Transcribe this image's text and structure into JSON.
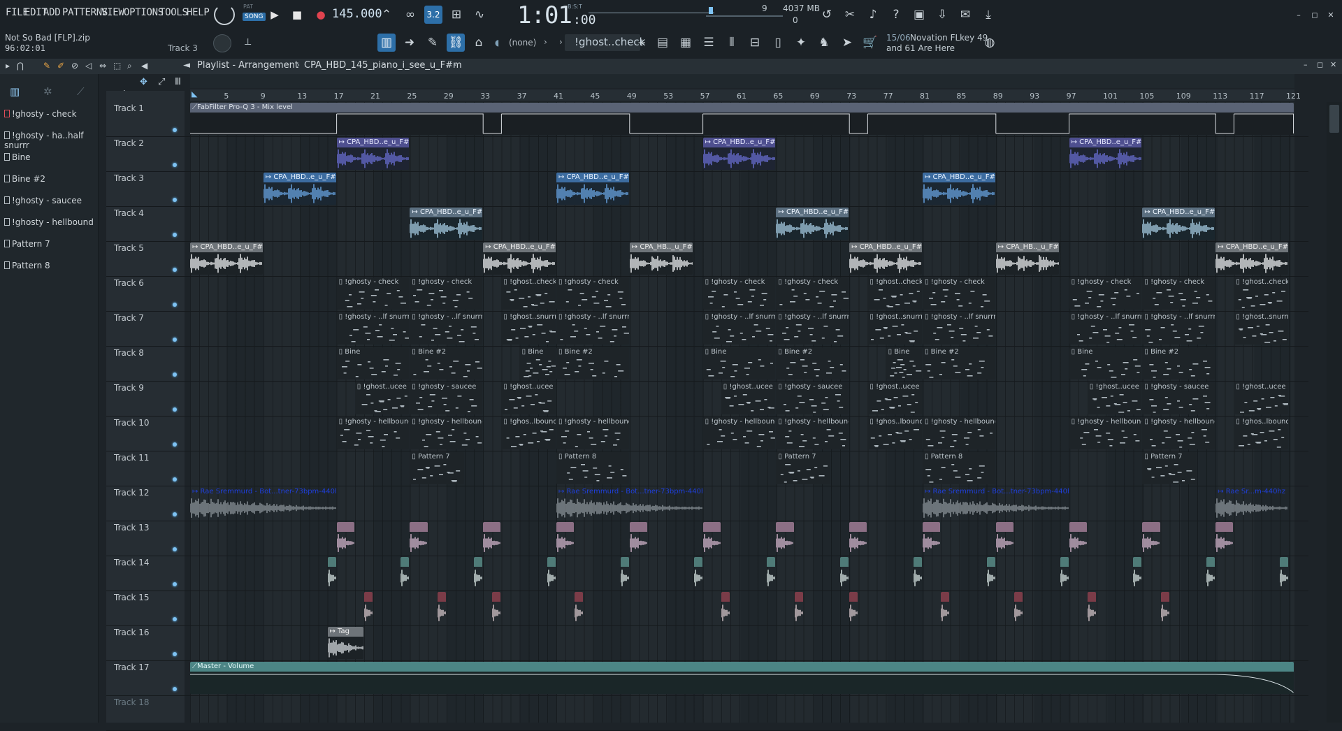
{
  "menu": [
    "FILE",
    "EDIT",
    "ADD",
    "PATTERNS",
    "VIEW",
    "OPTIONS",
    "TOOLS",
    "HELP"
  ],
  "mode": {
    "pat": "PAT",
    "song": "SONG"
  },
  "tempo": "145.000",
  "clock": {
    "main": "1:01",
    "sub": ":00",
    "label": "B:S:T"
  },
  "monitor": {
    "poly": "9",
    "mem": "4037 MB",
    "cpu": "0"
  },
  "project": {
    "name": "Not So Bad [FLP].zip",
    "time": "96:02:01"
  },
  "hint": "Track 3",
  "pattern_selector": {
    "current": "!ghost..check",
    "channel": "(none)"
  },
  "midi": {
    "count": "15/06",
    "device": "Novation FLkey 49",
    "more": "and 61 Are Here"
  },
  "playlist": {
    "title": "Playlist - Arrangement",
    "separator": "›",
    "arrangement": "CPA_HBD_145_piano_i_see_u_F#m"
  },
  "picker": [
    "!ghosty - check",
    "!ghosty - ha..half snurrr",
    "Bine",
    "Bine #2",
    "!ghosty - saucee",
    "!ghosty - hellbound",
    "Pattern 7",
    "Pattern 8"
  ],
  "ruler": [
    "5",
    "9",
    "13",
    "17",
    "21",
    "25",
    "29",
    "33",
    "37",
    "41",
    "45",
    "49",
    "53",
    "57",
    "61",
    "65",
    "69",
    "73",
    "77",
    "81",
    "85",
    "89",
    "93",
    "97",
    "101",
    "105",
    "109",
    "113",
    "117",
    "121"
  ],
  "tracks": [
    "Track 1",
    "Track 2",
    "Track 3",
    "Track 4",
    "Track 5",
    "Track 6",
    "Track 7",
    "Track 8",
    "Track 9",
    "Track 10",
    "Track 11",
    "Track 12",
    "Track 13",
    "Track 14",
    "Track 15",
    "Track 16",
    "Track 17",
    "Track 18"
  ],
  "clips": {
    "automation1": "FabFilter Pro-Q 3 - Mix level",
    "audio_full": "CPA_HBD..e_u_F#m",
    "audio_short": "CPA_HB.._u_F#m",
    "ghost_check": "!ghosty - check",
    "ghost_check_s": "!ghost..check",
    "ghost_snurrr": "!ghosty - ..lf snurrr",
    "ghost_snurrr_s": "!ghost..snurrr",
    "bine": "Bine",
    "bine2": "Bine #2",
    "saucee": "!ghosty - saucee",
    "saucee_s": "!ghost..ucee",
    "hellbound": "!ghosty - hellbound",
    "hellbound_s": "!ghos..lbound",
    "pattern7": "Pattern 7",
    "pattern8": "Pattern 8",
    "sample12": "Rae Sremmurd - Bot...tner-73bpm-440hz (1)",
    "sample12_s": "Rae Sr...m-440hz (1)",
    "tag": "Tag",
    "master": "Master - Volume"
  },
  "colors": {
    "accent": "#2d6fa8",
    "led": "#7ec2f2",
    "audio_wave_blue": "#6a6fd4",
    "audio_wave_lblue": "#6aa7e6",
    "audio_wave_cyan": "#a9cfe6",
    "audio_wave_white": "#f2f4f6"
  }
}
